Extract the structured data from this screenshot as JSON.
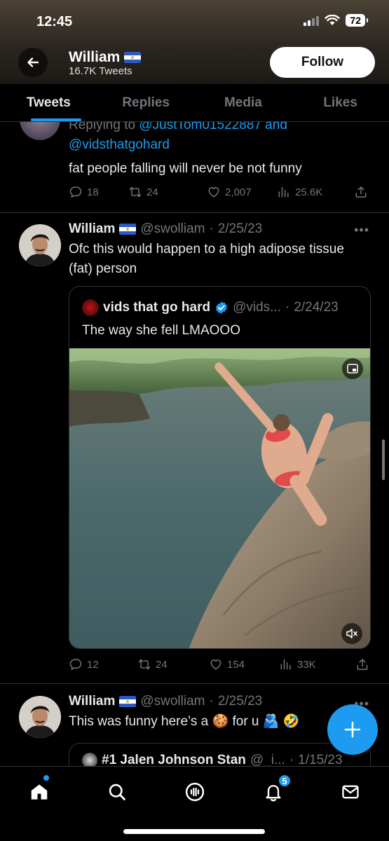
{
  "status_bar": {
    "time": "12:45",
    "battery": "72"
  },
  "profile": {
    "name": "William",
    "tweets_count": "16.7K Tweets",
    "follow_label": "Follow"
  },
  "tabs": [
    {
      "label": "Tweets",
      "active": true
    },
    {
      "label": "Replies",
      "active": false
    },
    {
      "label": "Media",
      "active": false
    },
    {
      "label": "Likes",
      "active": false
    }
  ],
  "tweet_reply": {
    "replying_prefix": "Replying to ",
    "replying_handle1": "@JustTom01522887",
    "replying_and": " and",
    "replying_handle2": "@vidsthatgohard",
    "text": "fat people falling will never be not funny",
    "replies": "18",
    "retweets": "24",
    "likes": "2,007",
    "views": "25.6K"
  },
  "tweet_main": {
    "name": "William",
    "handle": "@swolliam",
    "date": "2/25/23",
    "text": "Ofc this would happen to a high adipose tissue (fat) person",
    "quote": {
      "name": "vids that go hard",
      "handle": "@vids...",
      "date": "2/24/23",
      "text": "The way she fell LMAOOO"
    },
    "replies": "12",
    "retweets": "24",
    "likes": "154",
    "views": "33K"
  },
  "tweet_next": {
    "name": "William",
    "handle": "@swolliam",
    "date": "2/25/23",
    "text_before": "This was funny here’s a ",
    "emoji_cookie": "🍪",
    "text_mid": " for u ",
    "emoji_trail": "🫂 🤣",
    "quote": {
      "name": "#1 Jalen Johnson Stan",
      "handle": "@_i...",
      "date": "1/15/23"
    }
  },
  "nav": {
    "notifications_badge": "5"
  },
  "colors": {
    "accent": "#1d9bf0",
    "background": "#000000",
    "muted": "#71767b"
  }
}
